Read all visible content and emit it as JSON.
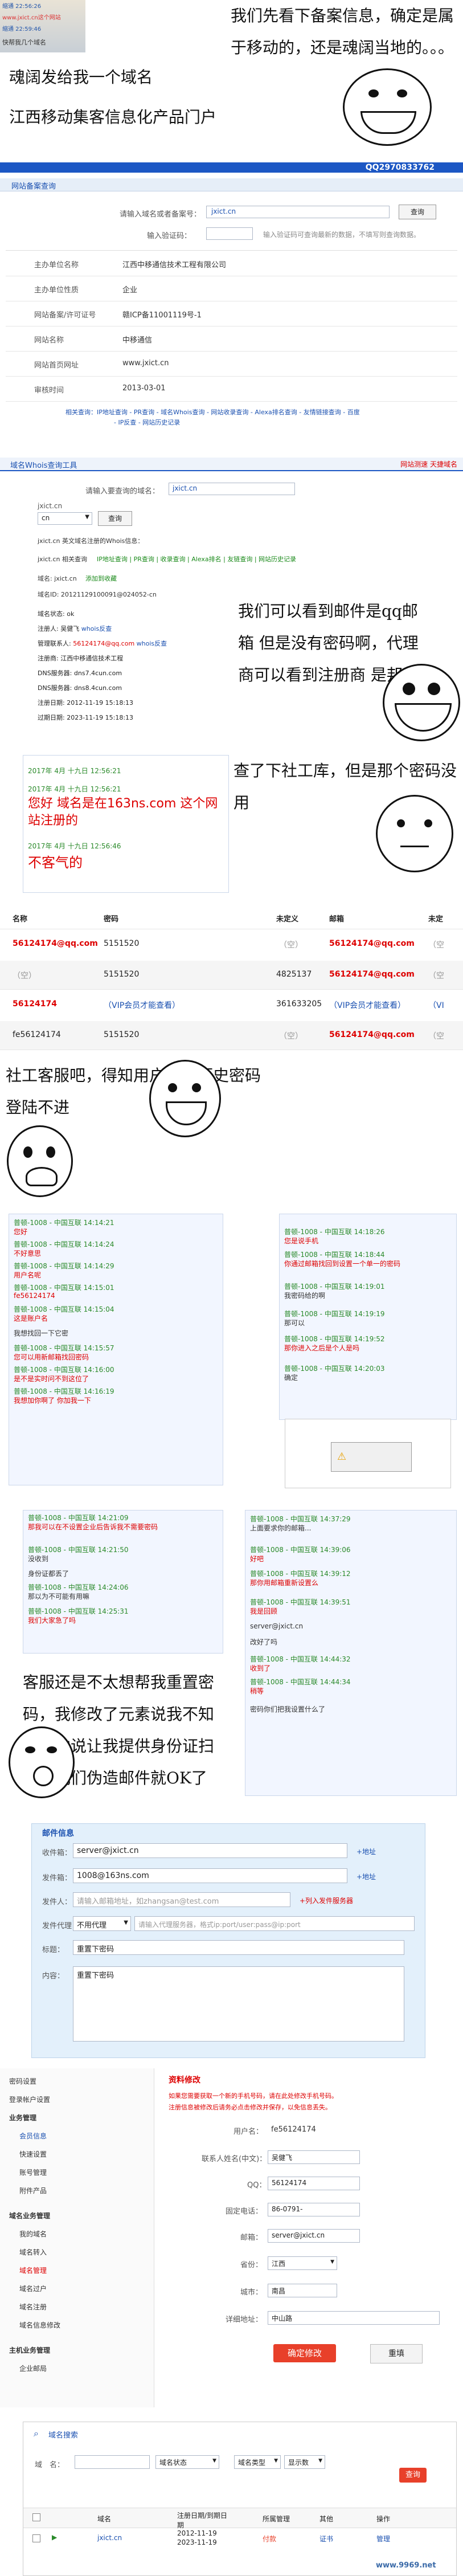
{
  "s1": {
    "phone_lines": [
      "缩通 22:56:26",
      "www.jxict.cn这个网站",
      "缩通 22:59:46",
      "快帮我几个域名"
    ],
    "caption_right": "我们先看下备案信息，确定是属于移动的，还是魂阔当地的。。。",
    "caption_left": "魂阔发给我一个域名",
    "caption_left2": "江西移动集客信息化产品门户"
  },
  "s2": {
    "banner": "QQ2970833762",
    "tab_label": "网站备案查询",
    "input_label": "请输入域名或者备案号：",
    "input_value": "jxict.cn",
    "captcha_label": "输入验证码：",
    "query_button": "查询",
    "hint": "输入验证码可查询最新的数据，不填写则查询数据。",
    "rows": [
      {
        "label": "主办单位名称",
        "value": "江西中移通信技术工程有限公司"
      },
      {
        "label": "主办单位性质",
        "value": "企业"
      },
      {
        "label": "网站备案/许可证号",
        "value": "赣ICP备11001119号-1"
      },
      {
        "label": "网站名称",
        "value": "中移通信"
      },
      {
        "label": "网站首页网址",
        "value": "www.jxict.cn"
      },
      {
        "label": "审核时间",
        "value": "2013-03-01"
      }
    ],
    "links1": "相关查询：IP地址查询 - PR查询 - 域名Whois查询 - 网站收录查询 - Alexa排名查询 - 友情链接查询 - 百度",
    "links2": "- IP反查 - 网站历史记录"
  },
  "s3": {
    "title": "域名Whois查询工具",
    "title_right": "网站测速 天捷域名",
    "input_label": "请输入要查询的域名：",
    "input_value": "jxict.cn",
    "domain_label": "jxict.cn",
    "select_value": "cn",
    "query_button": "查询",
    "subtitle": "jxict.cn 英文域名注册的Whois信息：",
    "related": "jxict.cn 相关查询",
    "related_links": "IP地址查询 | PR查询 | 收录查询 | Alexa排名 | 友链查询 | 网站历史记录",
    "whois_label": "域名: jxict.cn",
    "expand_link": "添加到收藏",
    "ids_line": "域名ID: 20121129100091@024052-cn",
    "lines": [
      {
        "k": "域名状态:",
        "v": "ok"
      },
      {
        "k": "注册人:",
        "v": "吴健飞",
        "link": "whois反查"
      },
      {
        "k": "管理联系人:",
        "v": "56124174@qq.com",
        "link": "whois反查"
      },
      {
        "k": "注册商:",
        "v": "江西中移通信技术工程"
      },
      {
        "k": "DNS服务器:",
        "v": "dns7.4cun.com"
      },
      {
        "k": "DNS服务器:",
        "v": "dns8.4cun.com"
      },
      {
        "k": "注册日期:",
        "v": "2012-11-19 15:18:13"
      },
      {
        "k": "过期日期:",
        "v": "2023-11-19 15:18:13"
      }
    ],
    "caption": "我们可以看到邮件是qq邮箱 但是没有密码啊，代理商可以看到注册商 是邦宁"
  },
  "s4": {
    "chat_lines": [
      "2017年 4月 十九日 12:56:21",
      "2017年 4月 十九日 12:56:21",
      "您好 域名是在163ns.com 这个网站注册的",
      "2017年 4月 十九日 12:56:46",
      "不客气的"
    ],
    "caption": "查了下社工库，但是那个密码没用"
  },
  "s5": {
    "headers": [
      "名称",
      "密码",
      "未定义",
      "邮箱",
      "未定"
    ],
    "rows": [
      [
        "56124174@qq.com",
        "5151520",
        "（空）",
        "56124174@qq.com",
        "（空"
      ],
      [
        "（空）",
        "5151520",
        "4825137",
        "56124174@qq.com",
        "（空"
      ],
      [
        "56124174",
        "（VIP会员才能查看）",
        "361633205",
        "（VIP会员才能查看）",
        "（VI"
      ],
      [
        "fe56124174",
        "5151520",
        "（空）",
        "56124174@qq.com",
        "（空"
      ]
    ]
  },
  "s6": {
    "caption": "社工客服吧，得知用户名，历史密码 登陆不进"
  },
  "s7": {
    "left_chat": [
      {
        "who": "普顿-1008 - 中国互联 14:14:21",
        "msg": "您好"
      },
      {
        "who": "普顿-1008 - 中国互联 14:14:24",
        "msg": "不好意思"
      },
      {
        "who": "普顿-1008 - 中国互联 14:14:29",
        "msg": "用户名呢"
      },
      {
        "who": "普顿-1008 - 中国互联 14:15:01",
        "msg": "fe56124174"
      },
      {
        "who": "普顿-1008 - 中国互联 14:15:04",
        "msg": "这是账户名"
      },
      {
        "who": "",
        "msg": "我想找回一下它密"
      },
      {
        "who": "普顿-1008 - 中国互联 14:15:57",
        "msg": "您可以用新邮箱找回密码"
      },
      {
        "who": "普顿-1008 - 中国互联 14:16:00",
        "msg": "是不是实时问不到这位了"
      },
      {
        "who": "普顿-1008 - 中国互联 14:16:19",
        "msg": "我想加你啊了 你加我一下"
      }
    ],
    "right_chat": [
      {
        "who": "普顿-1008 - 中国互联 14:18:26",
        "msg": "您是说手机"
      },
      {
        "who": "普顿-1008 - 中国互联 14:18:44",
        "msg": "你通过邮箱找回到设置一个单一的密码"
      },
      {
        "who": "普顿-1008 - 中国互联 14:19:01",
        "msg": "我密码给的啊"
      },
      {
        "who": "普顿-1008 - 中国互联 14:19:19",
        "msg": "那可以"
      },
      {
        "who": "普顿-1008 - 中国互联 14:19:52",
        "msg": "那你进入之后是个人是吗"
      },
      {
        "who": "普顿-1008 - 中国互联 14:20:03",
        "msg": "确定"
      }
    ]
  },
  "s8": {
    "left_chat": [
      {
        "who": "普顿-1008 - 中国互联 14:21:09",
        "msg": "那我可以在不设置企业后告诉我不需要密码"
      },
      {
        "who": "普顿-1008 - 中国互联 14:21:50",
        "msg": "没收到"
      },
      {
        "who": "",
        "msg": "身份证都丢了"
      },
      {
        "who": "普顿-1008 - 中国互联 14:24:06",
        "msg": "那以为不可能有用嘛"
      },
      {
        "who": "普顿-1008 - 中国互联 14:25:31",
        "msg": "我们大家急了吗"
      }
    ],
    "right_chat": [
      {
        "who": "普顿-1008 - 中国互联 14:37:29",
        "msg": "上面要求你的邮箱..."
      },
      {
        "who": "普顿-1008 - 中国互联 14:39:06",
        "msg": "好吧"
      },
      {
        "who": "普顿-1008 - 中国互联 14:39:12",
        "msg": "那你用邮箱重新设置么"
      },
      {
        "who": "普顿-1008 - 中国互联 14:39:51",
        "msg": "我是回顾"
      },
      {
        "who": "",
        "msg": "server@jxict.cn"
      },
      {
        "who": "",
        "msg": "改好了吗"
      },
      {
        "who": "普顿-1008 - 中国互联 14:44:32",
        "msg": "收到了"
      },
      {
        "who": "普顿-1008 - 中国互联 14:44:34",
        "msg": "稍等"
      },
      {
        "who": "",
        "msg": "密码你们把我设置什么了"
      }
    ],
    "caption": "客服还是不太想帮我重置密码，我修改了元素说我不知道，他说让我提供身份证扫描，我们伪造邮件就OK了"
  },
  "s9": {
    "title": "邮件信息",
    "rows": [
      {
        "label": "收件箱：",
        "value": "server@jxict.cn",
        "hint": "+地址"
      },
      {
        "label": "发件箱：",
        "value": "1008@163ns.com",
        "hint": "+地址"
      },
      {
        "label": "发件人：",
        "value": "请输入邮箱地址，如zhangsan@test.com",
        "hint": "+列入发件服务器"
      },
      {
        "label": "发件代理：",
        "value": "不用代理",
        "hint": "请输入代理服务器，格式ip:port/user:pass@ip:port"
      },
      {
        "label": "标题：",
        "value": "重置下密码",
        "hint": ""
      },
      {
        "label": "内容：",
        "value": "重置下密码",
        "hint": ""
      }
    ]
  },
  "s10": {
    "sidebar": [
      "密码设置",
      "登录帐户设置",
      "业务管理",
      "会员信息",
      "快速设置",
      "账号管理",
      "附件产品",
      "域名业务管理",
      "我的域名",
      "域名转入",
      "域名管理",
      "域名过户",
      "域名注册",
      "域名信息修改",
      "主机业务管理",
      "企业邮局"
    ],
    "title": "资料修改",
    "notice1": "如果您需要获取一个新的手机号码，请在此处修改手机号码。",
    "notice2": "注册信息被修改后请务必点击修改并保存，以免信息丢失。",
    "fields": [
      {
        "label": "用户名：",
        "value": "fe56124174"
      },
      {
        "label": "联系人姓名(中文)：",
        "value": "吴健飞"
      },
      {
        "label": "QQ：",
        "value": "56124174"
      },
      {
        "label": "固定电话：",
        "value": "86-0791-"
      },
      {
        "label": "邮箱：",
        "value": "server@jxict.cn"
      },
      {
        "label": "省份：",
        "value": "江西"
      },
      {
        "label": "城市：",
        "value": "南昌"
      },
      {
        "label": "详细地址：",
        "value": "中山路"
      }
    ],
    "save_button": "确定修改",
    "reset_button": "重填"
  },
  "s11": {
    "title": "域名搜索",
    "labels": [
      "域　名：",
      "域名状态",
      "域名类型",
      "显示数"
    ],
    "query_button": "查询",
    "headers": [
      "",
      "域名",
      "注册日期/到期日期",
      "",
      "所属管理",
      "其他",
      "操作"
    ],
    "row": [
      "jxict.cn",
      "2012-11-19",
      "2023-11-19",
      "付款",
      "证书",
      "管理"
    ],
    "watermark": "www.9969.net"
  }
}
